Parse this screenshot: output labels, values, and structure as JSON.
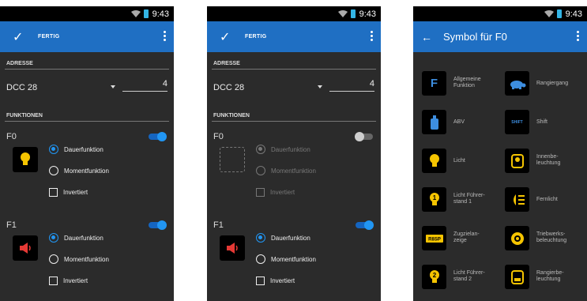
{
  "status_bar": {
    "time": "9:43",
    "time_truncated": "9:43"
  },
  "screen_edit": {
    "done_label": "FERTIG",
    "address_section": "ADRESSE",
    "dcc_protocol": "DCC 28",
    "dcc_address": "4",
    "functions_section": "FUNKTIONEN"
  },
  "functions": [
    {
      "name": "F0",
      "mode_permanent": "Dauerfunktion",
      "mode_momentary": "Momentfunktion",
      "inverted": "Invertiert"
    },
    {
      "name": "F1",
      "mode_permanent": "Dauerfunktion",
      "mode_momentary": "Momentfunktion",
      "inverted": "Invertiert"
    }
  ],
  "screen_symbols": {
    "title": "Symbol für F0",
    "symbols": [
      {
        "label": "Allgemeine\nFunktion",
        "icon": "letter-f-icon",
        "glyph": "F"
      },
      {
        "label": "Rangiergang",
        "icon": "turtle-icon"
      },
      {
        "label": "ABV",
        "icon": "abv-bottle-icon"
      },
      {
        "label": "Shift",
        "icon": "shift-icon",
        "glyph": "SHIFT"
      },
      {
        "label": "Licht",
        "icon": "light-bulb-icon"
      },
      {
        "label": "Innenbe-\nleuchtung",
        "icon": "interior-light-icon"
      },
      {
        "label": "Licht Führer-\nstand 1",
        "icon": "cab-light-1-icon",
        "glyph": "1"
      },
      {
        "label": "Fernlicht",
        "icon": "high-beam-icon"
      },
      {
        "label": "Zugzielan-\nzeige",
        "icon": "destination-display-icon",
        "glyph": "R8SP"
      },
      {
        "label": "Triebwerks-\nbeleuchtung",
        "icon": "engine-light-icon"
      },
      {
        "label": "Licht Führer-\nstand 2",
        "icon": "cab-light-2-icon",
        "glyph": "2"
      },
      {
        "label": "Rangierbe-\nleuchtung",
        "icon": "shunting-light-icon"
      }
    ]
  },
  "colors": {
    "accent": "#1f6fc3",
    "switch_on": "#2196f3",
    "icon_yellow": "#f5c400",
    "icon_blue": "#3d8ee0",
    "icon_red": "#e53935",
    "background": "#2b2b2b"
  }
}
